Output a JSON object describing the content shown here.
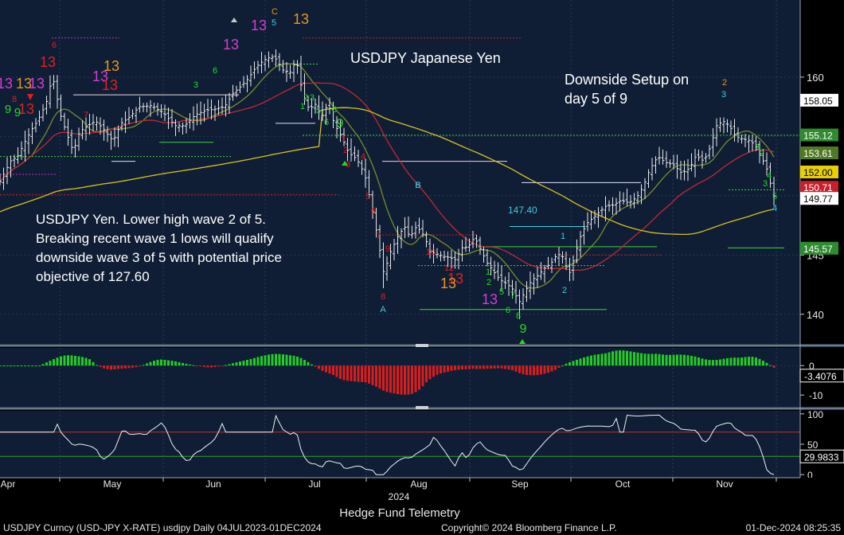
{
  "chart_data": {
    "type": "candlestick",
    "title": "USDJPY Japanese Yen",
    "comment": "Downside Setup on day 5 of 9",
    "note": [
      "USDJPY Yen.  Lower high wave 2 of 5.",
      "Breaking recent wave 1 lows will qualify",
      "downside wave 3 of 5 with potential price",
      "objective of 127.60"
    ],
    "x_months": [
      "Apr",
      "May",
      "Jun",
      "Jul",
      "Aug",
      "Sep",
      "Oct",
      "Nov"
    ],
    "x_year": "2024",
    "price_axis": {
      "ticks": [
        140,
        145,
        150,
        155,
        160
      ],
      "range": [
        137.5,
        166.5
      ]
    },
    "last_price": 149.77,
    "price_levels": [
      {
        "label": "158.05",
        "value": 158.05,
        "bg": "#ffffff",
        "fg": "#000000"
      },
      {
        "label": "155.12",
        "value": 155.12,
        "bg": "#2e8b2e",
        "fg": "#ffffff"
      },
      {
        "label": "153.61",
        "value": 153.61,
        "bg": "#4f7a22",
        "fg": "#ffffff"
      },
      {
        "label": "152.00",
        "value": 152.0,
        "bg": "#e8d000",
        "fg": "#000000"
      },
      {
        "label": "150.71",
        "value": 150.71,
        "bg": "#c8202a",
        "fg": "#ffffff"
      },
      {
        "label": "149.77",
        "value": 149.77,
        "bg": "#ffffff",
        "fg": "#000000"
      },
      {
        "label": "145.57",
        "value": 145.57,
        "bg": "#2e8b2e",
        "fg": "#ffffff"
      }
    ],
    "annotations": [
      {
        "text": "147.40",
        "value": 147.4
      },
      {
        "text": "B"
      },
      {
        "text": "A"
      }
    ],
    "macd": {
      "ticks": [
        0,
        -10
      ],
      "range": [
        -14,
        6
      ],
      "last": -3.4076,
      "last_label": "-3.4076"
    },
    "rsi": {
      "ticks": [
        100,
        50,
        0
      ],
      "range": [
        -5,
        105
      ],
      "last": 29.9833,
      "last_label": "29.9833",
      "overbought": 70,
      "oversold": 30
    },
    "moving_averages": [
      "fast (olive)",
      "mid (red)",
      "slow (yellow)"
    ],
    "footer": {
      "center": "Hedge Fund Telemetry",
      "left": "USDJPY Curncy (USD-JPY X-RATE) usdjpy  Daily 04JUL2023-01DEC2024",
      "middle": "Copyright© 2024 Bloomberg Finance L.P.",
      "right": "01-Dec-2024 08:25:35"
    },
    "colors": {
      "background": "#0f1e35",
      "grid": "#27395a",
      "up": "#ffffff",
      "green": "#22dd22",
      "red": "#e02020",
      "magenta": "#d43cd4",
      "orange": "#e8961e",
      "cyan": "#40c8e0"
    }
  }
}
